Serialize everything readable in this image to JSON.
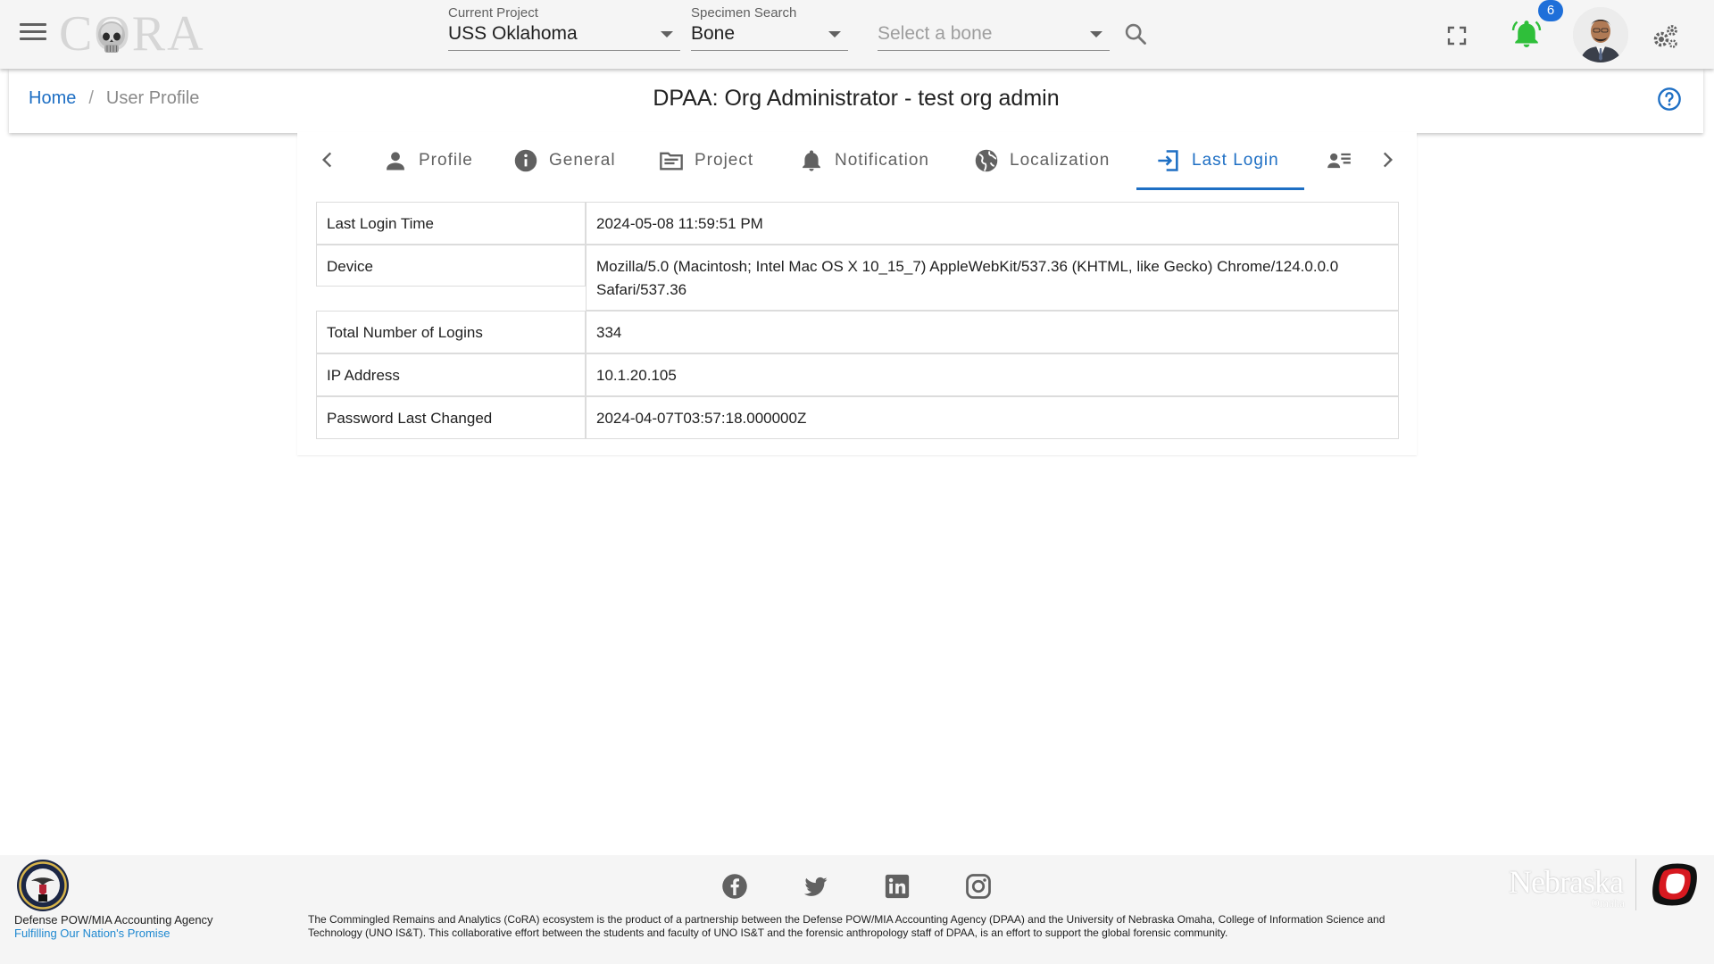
{
  "app": {
    "logo_text": "CORA",
    "menu_icon": "hamburger-icon"
  },
  "header": {
    "current_project": {
      "label": "Current Project",
      "value": "USS Oklahoma"
    },
    "specimen_search": {
      "label": "Specimen Search",
      "value": "Bone"
    },
    "bone_select": {
      "placeholder": "Select a bone"
    },
    "notification_count": "6",
    "colors": {
      "bell": "#2fbf3a",
      "badge": "#1e6fd9"
    }
  },
  "breadcrumb": {
    "home": "Home",
    "separator": "/",
    "current": "User Profile"
  },
  "page_title": "DPAA: Org Administrator - test org admin",
  "tabs": [
    {
      "label": "Profile",
      "icon": "person-icon",
      "active": false
    },
    {
      "label": "General",
      "icon": "info-icon",
      "active": false
    },
    {
      "label": "Project",
      "icon": "folder-icon",
      "active": false
    },
    {
      "label": "Notification",
      "icon": "bell-icon",
      "active": false
    },
    {
      "label": "Localization",
      "icon": "globe-icon",
      "active": false
    },
    {
      "label": "Last Login",
      "icon": "login-icon",
      "active": true
    },
    {
      "label": "",
      "icon": "contact-list-icon",
      "active": false
    }
  ],
  "last_login": [
    {
      "label": "Last Login Time",
      "value": "2024-05-08 11:59:51 PM"
    },
    {
      "label": "Device",
      "value": "Mozilla/5.0 (Macintosh; Intel Mac OS X 10_15_7) AppleWebKit/537.36 (KHTML, like Gecko) Chrome/124.0.0.0 Safari/537.36"
    },
    {
      "label": "Total Number of Logins",
      "value": "334"
    },
    {
      "label": "IP Address",
      "value": "10.1.20.105"
    },
    {
      "label": "Password Last Changed",
      "value": "2024-04-07T03:57:18.000000Z"
    }
  ],
  "footer": {
    "agency_name": "Defense POW/MIA Accounting Agency",
    "agency_motto": "Fulfilling Our Nation's Promise",
    "description": "The Commingled Remains and Analytics (CoRA) ecosystem is the product of a partnership between the Defense POW/MIA Accounting Agency (DPAA) and the University of Nebraska Omaha, College of Information Science and Technology (UNO IS&T). This collaborative effort between the students and faculty of UNO IS&T and the forensic anthropology staff of DPAA, is an effort to support the global forensic community.",
    "socials": [
      "facebook-icon",
      "twitter-icon",
      "linkedin-icon",
      "instagram-icon"
    ],
    "university_word": "Nebraska",
    "university_sub": "Omaha"
  }
}
